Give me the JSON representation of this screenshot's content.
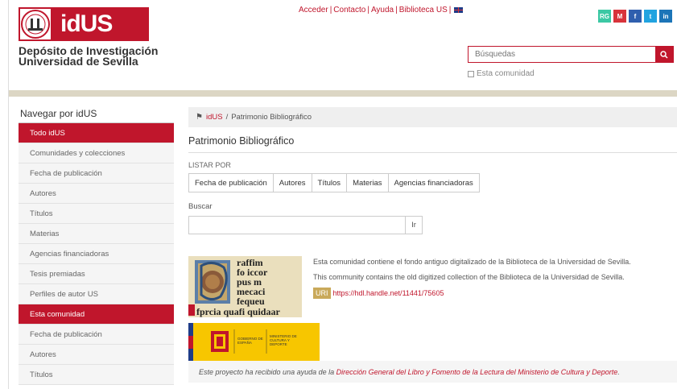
{
  "header": {
    "logo_text": "idUS",
    "site_title_line1": "Depósito de Investigación",
    "site_title_line2": "Universidad de Sevilla",
    "toplinks": [
      "Acceder",
      "Contacto",
      "Ayuda",
      "Biblioteca US"
    ],
    "social": [
      {
        "label": "RG",
        "color": "#3cc8a4",
        "icon": "researchgate-icon"
      },
      {
        "label": "M",
        "color": "#d8333b",
        "icon": "mendeley-icon"
      },
      {
        "label": "f",
        "color": "#2f5fae",
        "icon": "facebook-icon"
      },
      {
        "label": "t",
        "color": "#21a3e0",
        "icon": "twitter-icon"
      },
      {
        "label": "in",
        "color": "#1c75b8",
        "icon": "linkedin-icon"
      }
    ],
    "search_placeholder": "Búsquedas",
    "scope_label": "Esta comunidad"
  },
  "sidebar": {
    "title": "Navegar por idUS",
    "items": [
      {
        "label": "Todo idUS",
        "active": true
      },
      {
        "label": "Comunidades y colecciones",
        "active": false
      },
      {
        "label": "Fecha de publicación",
        "active": false
      },
      {
        "label": "Autores",
        "active": false
      },
      {
        "label": "Títulos",
        "active": false
      },
      {
        "label": "Materias",
        "active": false
      },
      {
        "label": "Agencias financiadoras",
        "active": false
      },
      {
        "label": "Tesis premiadas",
        "active": false
      },
      {
        "label": "Perfiles de autor US",
        "active": false
      },
      {
        "label": "Esta comunidad",
        "active": true
      },
      {
        "label": "Fecha de publicación",
        "active": false
      },
      {
        "label": "Autores",
        "active": false
      },
      {
        "label": "Títulos",
        "active": false
      }
    ]
  },
  "breadcrumb": {
    "home": "idUS",
    "separator": "/",
    "current": "Patrimonio Bibliográfico"
  },
  "main": {
    "title": "Patrimonio Bibliográfico",
    "listar_label": "LISTAR POR",
    "browse_tabs": [
      "Fecha de publicación",
      "Autores",
      "Títulos",
      "Materias",
      "Agencias financiadoras"
    ],
    "buscar_label": "Buscar",
    "buscar_button": "Ir",
    "desc_es": "Esta comunidad contiene el fondo antiguo digitalizado de la Biblioteca de la Universidad de Sevilla.",
    "desc_en": "This community contains the old digitized collection of the Biblioteca de la Universidad de Sevilla.",
    "uri_label": "URI",
    "uri": "https://hdl.handle.net/11441/75605",
    "manuscript_text": [
      "raffim",
      "fo iccor",
      "pus m",
      "mecaci",
      "fequeu",
      "fprcia quafi quidaar"
    ],
    "gov_text_1": "GOBIERNO DE ESPAÑA",
    "gov_text_2": "MINISTERIO DE CULTURA Y DEPORTE",
    "funding_pre": "Este proyecto ha recibido una ayuda de la ",
    "funding_link": "Dirección General del Libro y Fomento de la Lectura del Ministerio de Cultura y Deporte",
    "funding_post": "."
  },
  "colors": {
    "brand": "#c0162c",
    "band": "#dcd6c4",
    "gov_yellow": "#f7c600"
  }
}
